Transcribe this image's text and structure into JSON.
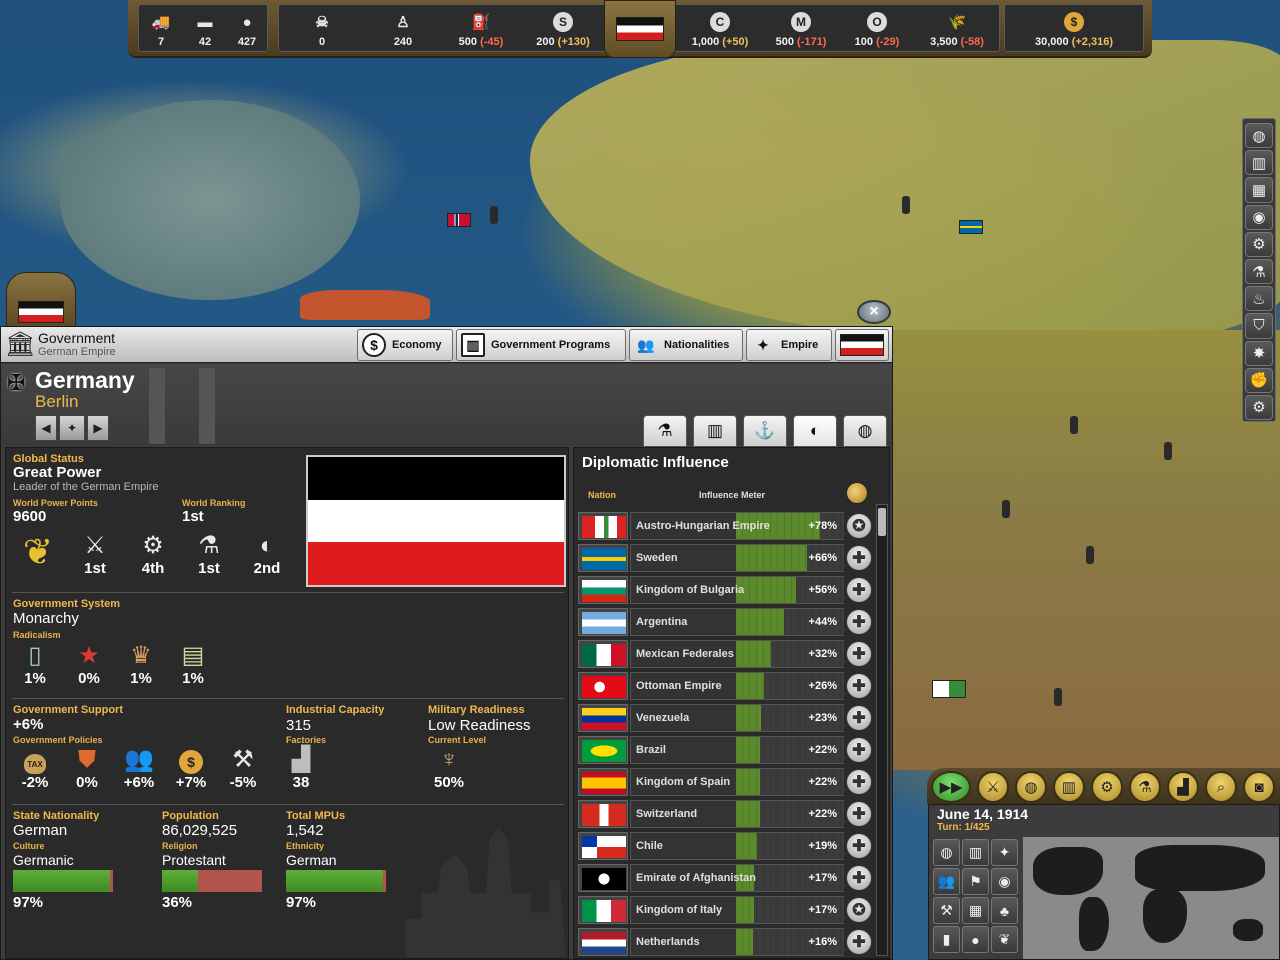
{
  "topbar": {
    "units": [
      {
        "icon": "truck-icon",
        "value": "7"
      },
      {
        "icon": "supply-wagon-icon",
        "value": "42"
      },
      {
        "icon": "manpower-icon",
        "value": "427"
      }
    ],
    "resources": [
      {
        "icon": "gas-mask-icon",
        "value": "0",
        "delta": ""
      },
      {
        "icon": "soldier-icon",
        "value": "240",
        "delta": ""
      },
      {
        "icon": "fuel-icon",
        "value": "500",
        "delta": "(-45)"
      },
      {
        "icon": "steel-icon",
        "value": "200",
        "delta": "(+130)"
      },
      {
        "icon": "coal-icon",
        "value": "1,000",
        "delta": "(+50)"
      },
      {
        "icon": "metal-icon",
        "value": "500",
        "delta": "(-171)"
      },
      {
        "icon": "oil-icon",
        "value": "100",
        "delta": "(-29)"
      },
      {
        "icon": "food-icon",
        "value": "3,500",
        "delta": "(-58)"
      }
    ],
    "money": {
      "icon": "money-icon",
      "value": "30,000",
      "delta": "(+2,316)"
    },
    "resource_letters": {
      "steel": "S",
      "coal": "C",
      "metal": "M",
      "oil": "O",
      "money": "$"
    }
  },
  "window": {
    "title": "Government",
    "subtitle": "German Empire",
    "tabs": [
      {
        "label": "Economy",
        "icon": "dollar-icon"
      },
      {
        "label": "Government Programs",
        "icon": "government-icon"
      },
      {
        "label": "Nationalities",
        "icon": "people-icon"
      },
      {
        "label": "Empire",
        "icon": "star-compass-icon"
      }
    ],
    "close_label": "×"
  },
  "nation": {
    "name": "Germany",
    "capital": "Berlin"
  },
  "global_status": {
    "label": "Global Status",
    "value": "Great Power",
    "description": "Leader of the German Empire",
    "wpp_label": "World Power Points",
    "wpp_value": "9600",
    "ranking_label": "World Ranking",
    "ranking_value": "1st",
    "ranks": [
      {
        "icon": "military-swords-icon",
        "value": "1st"
      },
      {
        "icon": "industry-gear-icon",
        "value": "4th"
      },
      {
        "icon": "science-flask-icon",
        "value": "1st"
      },
      {
        "icon": "diplomacy-ball-icon",
        "value": "2nd"
      }
    ]
  },
  "government_system": {
    "label": "Government System",
    "value": "Monarchy",
    "radicalism_label": "Radicalism",
    "radicalism": [
      {
        "icon": "pillar-icon",
        "value": "1%"
      },
      {
        "icon": "red-star-icon",
        "value": "0%"
      },
      {
        "icon": "eagle-icon",
        "value": "1%"
      },
      {
        "icon": "scroll-icon",
        "value": "1%"
      }
    ]
  },
  "government_support": {
    "label": "Government Support",
    "value": "+6%",
    "policies_label": "Government Policies",
    "policies": [
      {
        "icon": "tax-bag-icon",
        "value": "-2%",
        "text": "TAX"
      },
      {
        "icon": "badge-icon",
        "value": "0%"
      },
      {
        "icon": "population-icon",
        "value": "+6%"
      },
      {
        "icon": "coin-icon",
        "value": "+7%"
      },
      {
        "icon": "hammer-icon",
        "value": "-5%"
      }
    ]
  },
  "industrial_capacity": {
    "label": "Industrial Capacity",
    "value": "315",
    "factories_label": "Factories",
    "factories_value": "38"
  },
  "military_readiness": {
    "label": "Military Readiness",
    "value": "Low Readiness",
    "current_label": "Current Level",
    "current_value": "50%"
  },
  "demographics": {
    "state_nationality": {
      "label": "State Nationality",
      "value": "German",
      "sub_label": "Culture",
      "sub_value": "Germanic",
      "pct": "97%",
      "fill": 0.97
    },
    "population": {
      "label": "Population",
      "value": "86,029,525",
      "sub_label": "Religion",
      "sub_value": "Protestant",
      "pct": "36%",
      "fill": 0.36
    },
    "total_mpus": {
      "label": "Total MPUs",
      "value": "1,542",
      "sub_label": "Ethnicity",
      "sub_value": "German",
      "pct": "97%",
      "fill": 0.97
    }
  },
  "diplomacy": {
    "title": "Diplomatic Influence",
    "col_nation": "Nation",
    "col_meter": "Influence Meter",
    "rows": [
      {
        "nation": "Austro-Hungarian Empire",
        "pct": "+78%",
        "value": 78,
        "action": "star"
      },
      {
        "nation": "Sweden",
        "pct": "+66%",
        "value": 66,
        "action": "plus"
      },
      {
        "nation": "Kingdom of Bulgaria",
        "pct": "+56%",
        "value": 56,
        "action": "plus"
      },
      {
        "nation": "Argentina",
        "pct": "+44%",
        "value": 44,
        "action": "plus"
      },
      {
        "nation": "Mexican Federales",
        "pct": "+32%",
        "value": 32,
        "action": "plus"
      },
      {
        "nation": "Ottoman Empire",
        "pct": "+26%",
        "value": 26,
        "action": "plus"
      },
      {
        "nation": "Venezuela",
        "pct": "+23%",
        "value": 23,
        "action": "plus"
      },
      {
        "nation": "Brazil",
        "pct": "+22%",
        "value": 22,
        "action": "plus"
      },
      {
        "nation": "Kingdom of Spain",
        "pct": "+22%",
        "value": 22,
        "action": "plus"
      },
      {
        "nation": "Switzerland",
        "pct": "+22%",
        "value": 22,
        "action": "plus"
      },
      {
        "nation": "Chile",
        "pct": "+19%",
        "value": 19,
        "action": "plus"
      },
      {
        "nation": "Emirate of Afghanistan",
        "pct": "+17%",
        "value": 17,
        "action": "plus"
      },
      {
        "nation": "Kingdom of Italy",
        "pct": "+17%",
        "value": 17,
        "action": "star"
      },
      {
        "nation": "Netherlands",
        "pct": "+16%",
        "value": 16,
        "action": "plus"
      }
    ]
  },
  "date_panel": {
    "date": "June 14, 1914",
    "turn": "Turn: 1/425"
  },
  "colors": {
    "accent_yellow": "#f0b84e",
    "bar_green": "#4f9a2e",
    "bar_red": "#b0544c",
    "negative": "#ff6a4d"
  }
}
